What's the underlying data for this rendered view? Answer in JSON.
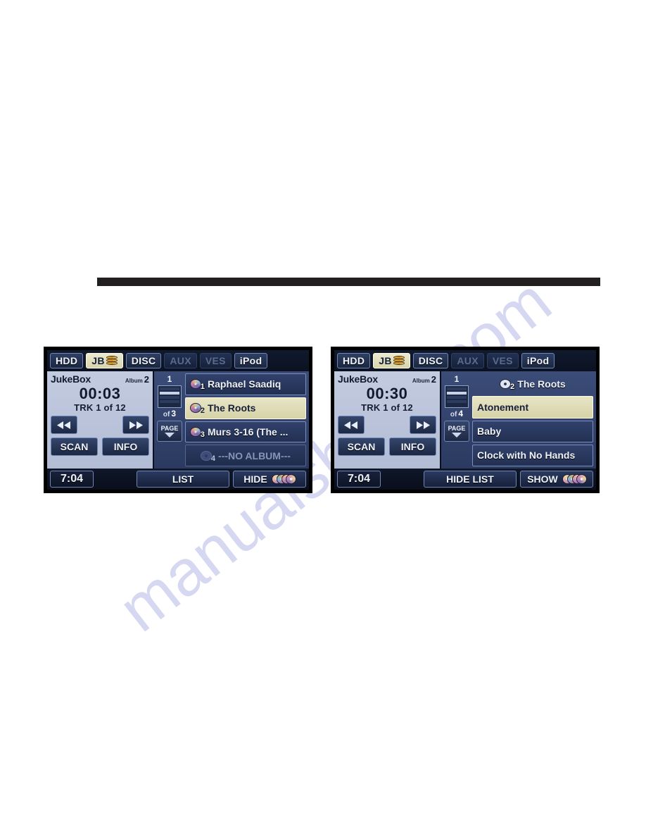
{
  "page": {
    "watermark": "manualsbase.com"
  },
  "units": [
    {
      "id": "album-list-screen",
      "tabs": [
        {
          "label": "HDD",
          "state": "normal",
          "icon": ""
        },
        {
          "label": "JB",
          "state": "active",
          "icon": "disc-stack-icon"
        },
        {
          "label": "DISC",
          "state": "normal",
          "icon": ""
        },
        {
          "label": "AUX",
          "state": "disabled",
          "icon": ""
        },
        {
          "label": "VES",
          "state": "disabled",
          "icon": ""
        },
        {
          "label": "iPod",
          "state": "normal",
          "icon": ""
        }
      ],
      "info": {
        "source": "JukeBox",
        "album_label": "Album",
        "album_number": "2",
        "elapsed": "00:03",
        "track_status": "TRK 1 of 12",
        "prev_icon": "rewind-icon",
        "next_icon": "fast-forward-icon",
        "scan_label": "SCAN",
        "info_label": "INFO"
      },
      "pager": {
        "current_page": "1",
        "of_label": "of",
        "total_pages": "3",
        "page_button_label": "PAGE",
        "page_button_icon": "chevron-down-icon"
      },
      "rows": [
        {
          "kind": "item",
          "number": "1",
          "label": "Raphael Saadiq",
          "icon": "disc-icon",
          "selected": false
        },
        {
          "kind": "item",
          "number": "2",
          "label": "The Roots",
          "icon": "disc-icon",
          "selected": true
        },
        {
          "kind": "item",
          "number": "3",
          "label": "Murs 3-16 (The ...",
          "icon": "disc-icon",
          "selected": false
        },
        {
          "kind": "empty",
          "number": "4",
          "label": "---NO ALBUM---",
          "icon": "disc-icon-dim",
          "selected": false
        }
      ],
      "bottom": {
        "clock": "7:04",
        "center_label": "LIST",
        "right_label": "HIDE",
        "right_icon": "disc-fan-icon"
      }
    },
    {
      "id": "track-list-screen",
      "tabs": [
        {
          "label": "HDD",
          "state": "normal",
          "icon": ""
        },
        {
          "label": "JB",
          "state": "active",
          "icon": "disc-stack-icon"
        },
        {
          "label": "DISC",
          "state": "normal",
          "icon": ""
        },
        {
          "label": "AUX",
          "state": "disabled",
          "icon": ""
        },
        {
          "label": "VES",
          "state": "disabled",
          "icon": ""
        },
        {
          "label": "iPod",
          "state": "normal",
          "icon": ""
        }
      ],
      "info": {
        "source": "JukeBox",
        "album_label": "Album",
        "album_number": "2",
        "elapsed": "00:30",
        "track_status": "TRK 1 of 12",
        "prev_icon": "rewind-icon",
        "next_icon": "fast-forward-icon",
        "scan_label": "SCAN",
        "info_label": "INFO"
      },
      "pager": {
        "current_page": "1",
        "of_label": "of",
        "total_pages": "4",
        "page_button_label": "PAGE",
        "page_button_icon": "chevron-down-icon"
      },
      "rows": [
        {
          "kind": "header",
          "number": "2",
          "label": "The Roots",
          "icon": "disc-icon-plain",
          "selected": false
        },
        {
          "kind": "item",
          "number": "",
          "label": "Atonement",
          "icon": "",
          "selected": true
        },
        {
          "kind": "item",
          "number": "",
          "label": "Baby",
          "icon": "",
          "selected": false
        },
        {
          "kind": "item",
          "number": "",
          "label": "Clock with No Hands",
          "icon": "",
          "selected": false
        }
      ],
      "bottom": {
        "clock": "7:04",
        "center_label": "HIDE LIST",
        "right_label": "SHOW",
        "right_icon": "disc-fan-icon"
      }
    }
  ]
}
